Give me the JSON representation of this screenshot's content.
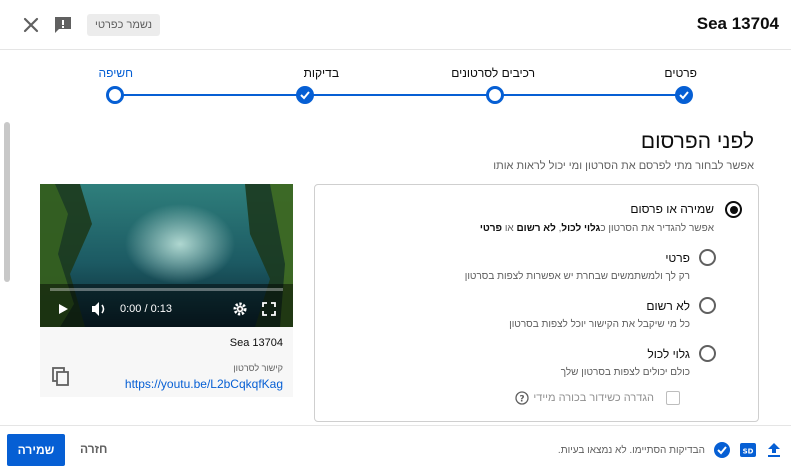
{
  "header": {
    "title": "Sea 13704",
    "saved_chip": "נשמר כפרטי",
    "close_icon": "close-icon",
    "feedback_icon": "feedback-icon"
  },
  "stepper": {
    "steps": [
      {
        "label": "פרטים",
        "state": "done"
      },
      {
        "label": "רכיבים לסרטונים",
        "state": "done"
      },
      {
        "label": "בדיקות",
        "state": "done"
      },
      {
        "label": "חשיפה",
        "state": "active"
      }
    ],
    "accent_color": "#065fd4"
  },
  "visibility": {
    "title": "לפני הפרסום",
    "subtitle": "אפשר לבחור מתי לפרסם את הסרטון ומי יכול לראות אותו",
    "save_or_publish": {
      "label": "שמירה או פרסום",
      "desc_prefix": "אפשר להגדיר את הסרטון כ",
      "desc_public": "גלוי לכול",
      "desc_sep": ", ",
      "desc_unlisted": "לא רשום",
      "desc_or": " או ",
      "desc_private": "פרטי"
    },
    "options": [
      {
        "label": "פרטי",
        "desc": "רק לך ולמשתמשים שבחרת יש אפשרות לצפות בסרטון"
      },
      {
        "label": "לא רשום",
        "desc": "כל מי שיקבל את הקישור יוכל לצפות בסרטון"
      },
      {
        "label": "גלוי לכול",
        "desc": "כולם יכולים לצפות בסרטון שלך"
      }
    ],
    "premiere_label": "הגדרה כשידור בכורה מיידי"
  },
  "video": {
    "time": "0:00 / 0:13",
    "name": "Sea 13704",
    "link_label": "קישור לסרטון",
    "link": "https://youtu.be/L2bCqkqfKag"
  },
  "footer": {
    "status": "הבדיקות הסתיימו. לא נמצאו בעיות.",
    "back_label": "חזרה",
    "save_label": "שמירה",
    "sd_badge": "SD"
  }
}
